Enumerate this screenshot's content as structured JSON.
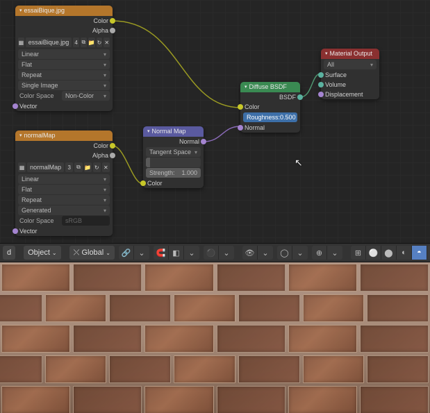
{
  "nodes": {
    "tex1": {
      "title": "essaiBique.jpg",
      "out_color": "Color",
      "out_alpha": "Alpha",
      "img_name": "essaiBique.jpg",
      "img_users": "4",
      "interp": "Linear",
      "proj": "Flat",
      "ext": "Repeat",
      "source": "Single Image",
      "cs_label": "Color Space",
      "cs_value": "Non-Color",
      "vector": "Vector"
    },
    "tex2": {
      "title": "normalMap",
      "out_color": "Color",
      "out_alpha": "Alpha",
      "img_name": "normalMap",
      "img_users": "3",
      "interp": "Linear",
      "proj": "Flat",
      "ext": "Repeat",
      "source": "Generated",
      "cs_label": "Color Space",
      "cs_value": "sRGB",
      "vector": "Vector"
    },
    "nmap": {
      "title": "Normal Map",
      "out_normal": "Normal",
      "space": "Tangent Space",
      "strength_label": "Strength:",
      "strength_value": "1.000",
      "color": "Color"
    },
    "diffuse": {
      "title": "Diffuse BSDF",
      "out_bsdf": "BSDF",
      "color": "Color",
      "roughness_label": "Roughness:",
      "roughness_value": "0.500",
      "normal": "Normal"
    },
    "output": {
      "title": "Material Output",
      "target": "All",
      "surface": "Surface",
      "volume": "Volume",
      "displacement": "Displacement"
    }
  },
  "toolbar": {
    "mode_trunc": "d",
    "mode": "Object",
    "orient": "Global",
    "chev": "⌄"
  },
  "icons": {
    "img": "▦",
    "folder": "📁",
    "pack": "⧉",
    "reload": "↻",
    "x": "✕",
    "tri": "▾",
    "link": "🔗",
    "move": "↔",
    "rot": "⟳",
    "scale": "⤢",
    "xform": "◧",
    "snap": "🧲",
    "pe": "⚫",
    "vis": "👁",
    "giz": "◯",
    "over": "⊕",
    "s1": "⊞",
    "s2": "⚪",
    "s3": "⬤",
    "s4": "◐",
    "s5": "◒",
    "s6": "◓"
  }
}
